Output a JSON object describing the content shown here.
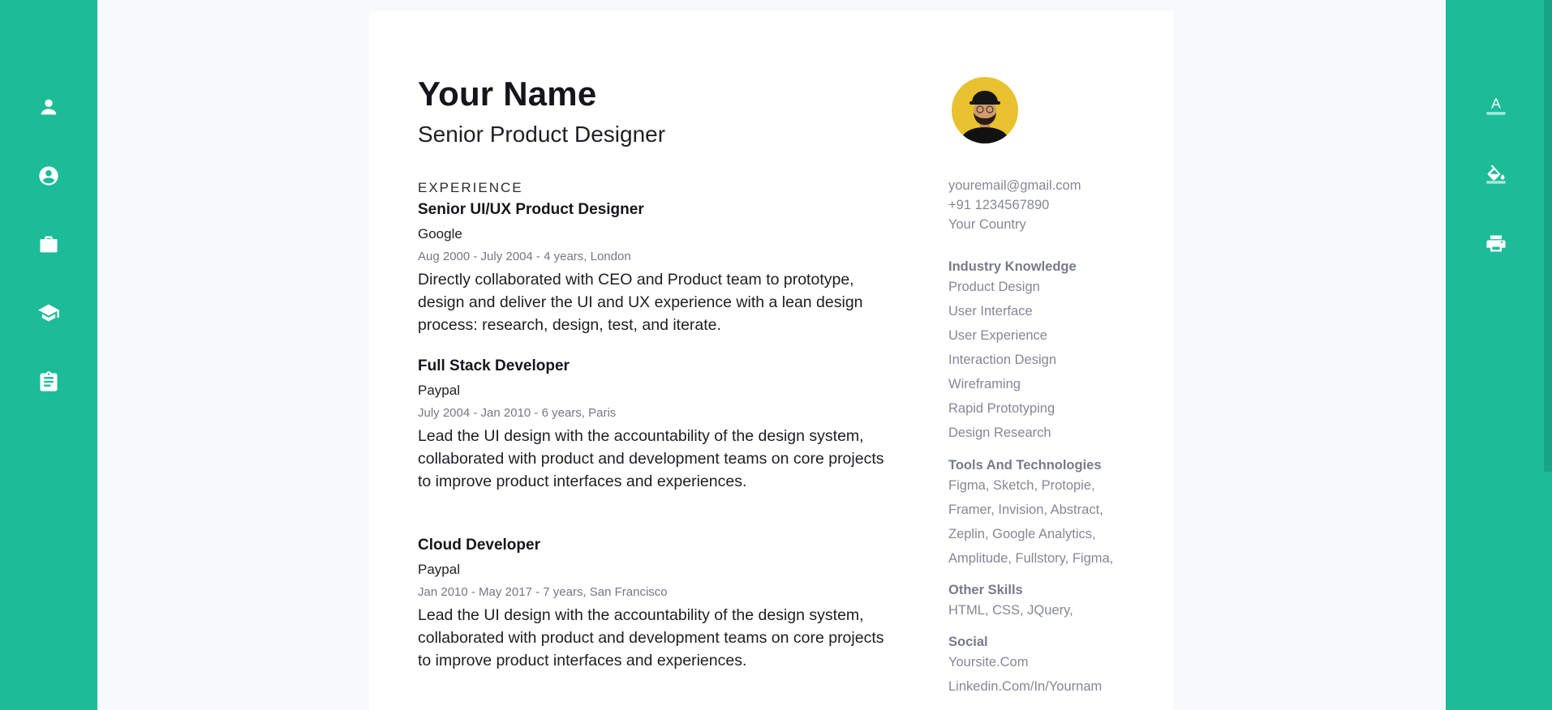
{
  "left_nav": {
    "items": [
      {
        "icon": "person-icon",
        "label": ""
      },
      {
        "icon": "account-circle-icon",
        "label": ""
      },
      {
        "icon": "briefcase-icon",
        "label": ""
      },
      {
        "icon": "graduation-cap-icon",
        "label": ""
      },
      {
        "icon": "clipboard-icon",
        "label": ""
      }
    ]
  },
  "right_tools": {
    "items": [
      {
        "icon": "text-color-icon",
        "glyph": "A"
      },
      {
        "icon": "paint-bucket-icon"
      },
      {
        "icon": "print-icon"
      }
    ]
  },
  "resume": {
    "name": "Your Name",
    "role": "Senior Product Designer",
    "experience_heading": "EXPERIENCE",
    "jobs": [
      {
        "title": "Senior UI/UX Product Designer",
        "company": "Google",
        "dates": "Aug 2000 - July 2004 - 4 years, London",
        "description": "Directly collaborated with CEO and Product team to prototype, design and deliver the UI and UX experience with a lean design process: research, design, test, and iterate."
      },
      {
        "title": "Full Stack Developer",
        "company": "Paypal",
        "dates": "July 2004 - Jan 2010 - 6 years, Paris",
        "description": "Lead the UI design with the accountability of the design system, collaborated with product and development teams on core projects to improve product interfaces and experiences."
      },
      {
        "title": "Cloud Developer",
        "company": "Paypal",
        "dates": "Jan 2010 - May 2017 - 7 years, San Francisco",
        "description": "Lead the UI design with the accountability of the design system, collaborated with product and development teams on core projects to improve product interfaces and experiences."
      }
    ],
    "contact": {
      "email": "youremail@gmail.com",
      "phone": "+91 1234567890",
      "country": "Your Country"
    },
    "industry_knowledge": {
      "heading": "Industry Knowledge",
      "items": [
        "Product Design",
        "User Interface",
        "User Experience",
        "Interaction Design",
        "Wireframing",
        "Rapid Prototyping",
        "Design Research"
      ]
    },
    "tools": {
      "heading": "Tools And Technologies",
      "lines": [
        "Figma, Sketch, Protopie,",
        "Framer, Invision, Abstract,",
        "Zeplin, Google Analytics,",
        "Amplitude, Fullstory, Figma,"
      ]
    },
    "other_skills": {
      "heading": "Other Skills",
      "text": "HTML, CSS, JQuery,"
    },
    "social": {
      "heading": "Social",
      "items": [
        "Yoursite.Com",
        "Linkedin.Com/In/Yournam"
      ]
    }
  },
  "colors": {
    "accent": "#1cbc98",
    "page_background": "#f7f9fc",
    "paper": "#ffffff",
    "avatar_background": "#e8c12e"
  }
}
